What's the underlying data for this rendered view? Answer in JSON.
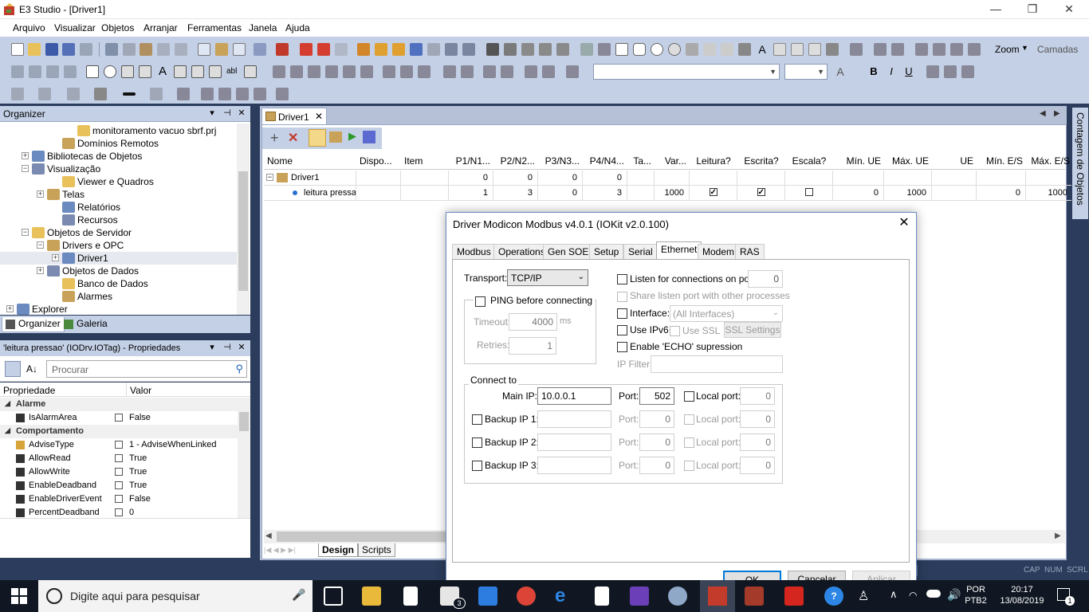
{
  "window": {
    "title": "E3 Studio - [Driver1]",
    "minimize": "—",
    "restore": "❐",
    "close": "✕"
  },
  "menu": [
    "Arquivo",
    "Visualizar",
    "Objetos",
    "Arranjar",
    "Ferramentas",
    "Janela",
    "Ajuda"
  ],
  "toolbar": {
    "zoom_label": "Zoom",
    "layers_label": "Camadas"
  },
  "organizer": {
    "title": "Organizer",
    "tree": [
      {
        "label": "monitoramento vacuo sbrf.prj",
        "depth": 4,
        "exp": ""
      },
      {
        "label": "Domínios Remotos",
        "depth": 3,
        "exp": ""
      },
      {
        "label": "Bibliotecas de Objetos",
        "depth": 1,
        "exp": "+"
      },
      {
        "label": "Visualização",
        "depth": 1,
        "exp": "−"
      },
      {
        "label": "Viewer e Quadros",
        "depth": 3,
        "exp": ""
      },
      {
        "label": "Telas",
        "depth": 2,
        "exp": "+"
      },
      {
        "label": "Relatórios",
        "depth": 3,
        "exp": ""
      },
      {
        "label": "Recursos",
        "depth": 3,
        "exp": ""
      },
      {
        "label": "Objetos de Servidor",
        "depth": 1,
        "exp": "−"
      },
      {
        "label": "Drivers e OPC",
        "depth": 2,
        "exp": "−"
      },
      {
        "label": "Driver1",
        "depth": 3,
        "exp": "+"
      },
      {
        "label": "Objetos de Dados",
        "depth": 2,
        "exp": "+"
      },
      {
        "label": "Banco de Dados",
        "depth": 3,
        "exp": ""
      },
      {
        "label": "Alarmes",
        "depth": 3,
        "exp": ""
      },
      {
        "label": "Explorer",
        "depth": 0,
        "exp": "+"
      }
    ],
    "tabs": [
      "Organizer",
      "Galeria"
    ]
  },
  "properties": {
    "title": "'leitura pressao' (IODrv.IOTag) - Propriedades",
    "search_placeholder": "Procurar",
    "col_property": "Propriedade",
    "col_value": "Valor",
    "rows": [
      {
        "cat": true,
        "name": "Alarme"
      },
      {
        "name": "IsAlarmArea",
        "value": "False"
      },
      {
        "cat": true,
        "name": "Comportamento"
      },
      {
        "name": "AdviseType",
        "value": "1 - AdviseWhenLinked"
      },
      {
        "name": "AllowRead",
        "value": "True"
      },
      {
        "name": "AllowWrite",
        "value": "True"
      },
      {
        "name": "EnableDeadband",
        "value": "True"
      },
      {
        "name": "EnableDriverEvent",
        "value": "False"
      },
      {
        "name": "PercentDeadband",
        "value": "0"
      }
    ]
  },
  "document": {
    "tab_label": "Driver1",
    "columns": [
      "Nome",
      "Dispo...",
      "Item",
      "P1/N1...",
      "P2/N2...",
      "P3/N3...",
      "P4/N4...",
      "Ta...",
      "Var...",
      "Leitura?",
      "Escrita?",
      "Escala?",
      "Mín. UE",
      "Máx. UE",
      "UE",
      "Mín. E/S",
      "Máx. E/S"
    ],
    "rows": [
      {
        "name": "Driver1",
        "p1": "0",
        "p2": "0",
        "p3": "0",
        "p4": "0"
      },
      {
        "name": "leitura pressa",
        "p1": "1",
        "p2": "3",
        "p3": "0",
        "p4": "3",
        "var": "1000",
        "read": true,
        "write": true,
        "scale": false,
        "min_ue": "0",
        "max_ue": "1000",
        "min_es": "0",
        "max_es": "1000"
      }
    ],
    "bottom_tabs": [
      "Design",
      "Scripts"
    ]
  },
  "right_tab": "Contagem de Objetos",
  "statusbar": {
    "cap": "CAP",
    "num": "NUM",
    "scrl": "SCRL"
  },
  "dialog": {
    "title": "Driver Modicon Modbus v4.0.1 (IOKit v2.0.100)",
    "tabs": [
      "Modbus",
      "Operations",
      "Gen SOE",
      "Setup",
      "Serial",
      "Ethernet",
      "Modem",
      "RAS"
    ],
    "active_tab": "Ethernet",
    "transport_label": "Transport:",
    "transport_value": "TCP/IP",
    "ping_label": "PING before connecting",
    "timeout_label": "Timeout:",
    "timeout_value": "4000",
    "timeout_unit": "ms",
    "retries_label": "Retries:",
    "retries_value": "1",
    "listen_label": "Listen for connections on port:",
    "listen_value": "0",
    "share_label": "Share listen port with other processes",
    "interface_label": "Interface:",
    "interface_value": "(All Interfaces)",
    "ipv6_label": "Use IPv6",
    "ssl_label": "Use SSL",
    "ssl_settings": "SSL Settings",
    "echo_label": "Enable 'ECHO' supression",
    "ipfilter_label": "IP Filter:",
    "connect_label": "Connect to",
    "main_ip_label": "Main IP:",
    "main_ip_value": "10.0.0.1",
    "port_label": "Port:",
    "main_port_value": "502",
    "local_port_label": "Local port:",
    "local_port_value": "0",
    "backups": [
      {
        "label": "Backup IP 1:",
        "port": "0",
        "local": "0"
      },
      {
        "label": "Backup IP 2:",
        "port": "0",
        "local": "0"
      },
      {
        "label": "Backup IP 3:",
        "port": "0",
        "local": "0"
      }
    ],
    "ok": "OK",
    "cancel": "Cancelar",
    "apply": "Aplicar"
  },
  "taskbar": {
    "search_placeholder": "Digite aqui para pesquisar",
    "mail_badge": "3",
    "lang_top": "POR",
    "lang_bottom": "PTB2",
    "time": "20:17",
    "date": "13/08/2019",
    "notif_count": "1"
  },
  "colors": {
    "accent": "#0078d7",
    "chrome": "#c4d0e6",
    "dark": "#2b3c5c"
  }
}
